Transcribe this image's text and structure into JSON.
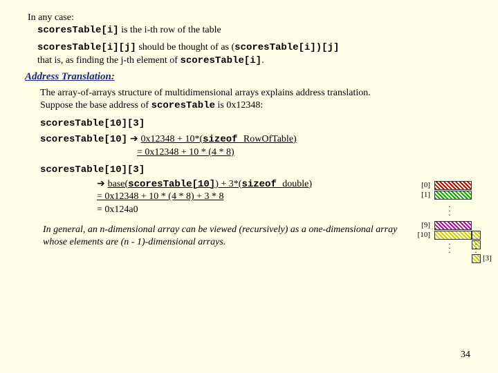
{
  "intro": "In any case:",
  "row_expr": "scoresTable[i]",
  "row_text": " is the i-th row of the table",
  "ij_expr": "scoresTable[i][j]",
  "ij_mid": " should be thought of as (",
  "ij_paren": "scoresTable[i])[j]",
  "ij_tail": "that is, as finding the j-th element of ",
  "ij_tail_code": "scoresTable[i]",
  "heading": "Address Translation:",
  "explain1": "The array-of-arrays structure of multidimensional arrays explains address translation.",
  "explain2a": "Suppose the base address of ",
  "explain2b": "scoresTable",
  "explain2c": " is 0x12348:",
  "target_expr": "scoresTable[10][3]",
  "calc1_lhs": "scoresTable[10]",
  "calc1_arrow": " ➔ ",
  "calc1_rhs1": "0x12348 + 10*(",
  "calc1_sizeof": "sizeof ",
  "calc1_type": "RowOfTable",
  "calc1_rhs2": ")",
  "calc1_line2": "= 0x12348 + 10 * (4 * 8)",
  "calc2_lhs": "scoresTable[10][3]",
  "calc2_arrow": "➔ ",
  "calc2_rhs1": "base(",
  "calc2_rhs1b": "scoresTable[10]",
  "calc2_rhs1c": ") + 3*(",
  "calc2_sizeof": "sizeof ",
  "calc2_type": "double",
  "calc2_rhs2": ")",
  "calc2_line2": "= 0x12348 + 10 * (4 * 8) + 3 * 8",
  "calc2_line3": "= 0x124a0",
  "general": "In general, an n-dimensional array can be viewed (recursively) as a one-dimensional array whose elements are (n - 1)-dimensional arrays.",
  "pagenum": "34",
  "diag": {
    "r0": "[0]",
    "r1": "[1]",
    "r9": "[9]",
    "r10": "[10]",
    "c3": "[3]"
  }
}
